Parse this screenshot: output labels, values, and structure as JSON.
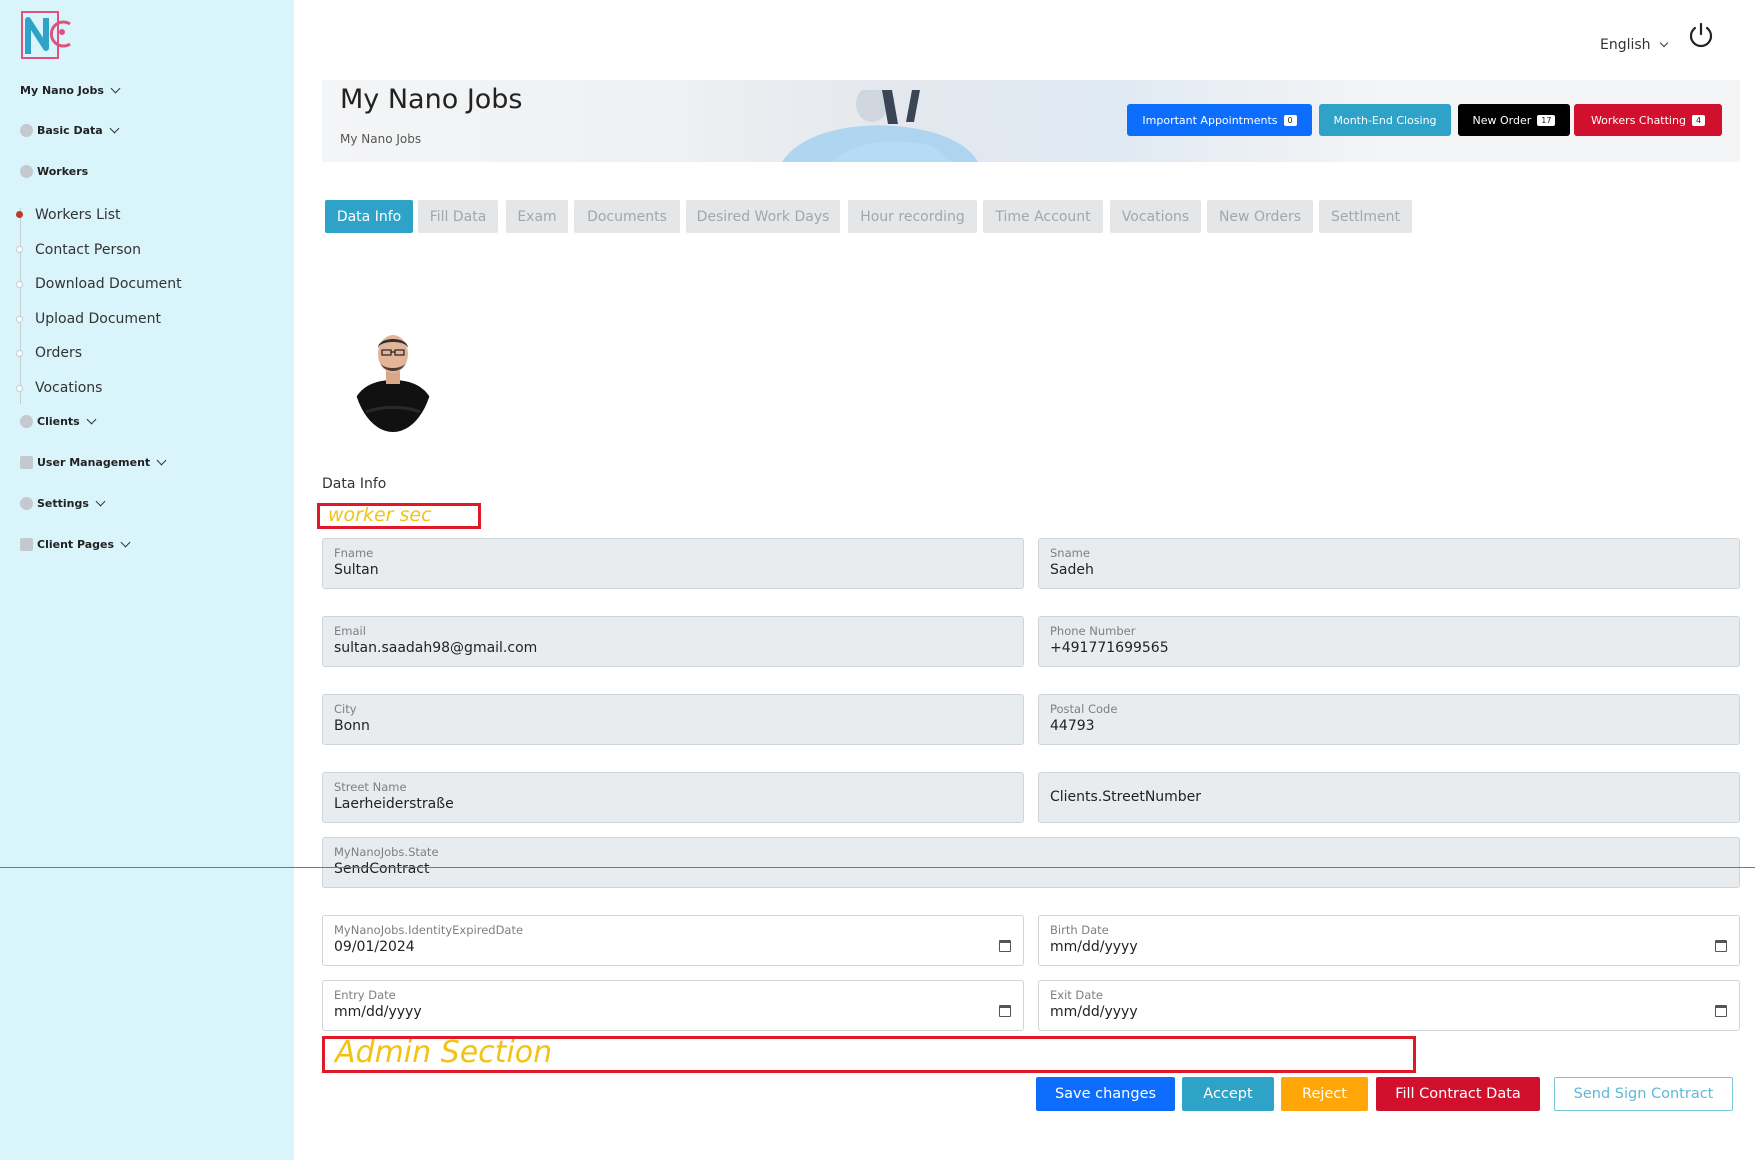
{
  "sidebar": {
    "groups": [
      {
        "label": "My Nano Jobs",
        "icon": "none"
      },
      {
        "label": "Basic Data",
        "icon": "database-icon"
      },
      {
        "label": "Workers",
        "icon": "user-icon"
      },
      {
        "label": "Clients",
        "icon": "users-icon"
      },
      {
        "label": "User Management",
        "icon": "user-cog-icon"
      },
      {
        "label": "Settings",
        "icon": "gear-icon"
      },
      {
        "label": "Client Pages",
        "icon": "page-icon"
      }
    ],
    "worker_items": [
      "Workers List",
      "Contact Person",
      "Download Document",
      "Upload Document",
      "Orders",
      "Vocations"
    ]
  },
  "topbar": {
    "language": "English"
  },
  "header": {
    "title": "My Nano Jobs",
    "breadcrumb": "My Nano Jobs",
    "buttons": [
      {
        "label": "Important Appointments",
        "badge": "0",
        "color": "#0d6efd"
      },
      {
        "label": "Month-End Closing",
        "badge": "",
        "color": "#2fa3c7"
      },
      {
        "label": "New Order",
        "badge": "17",
        "color": "#000000"
      },
      {
        "label": "Workers Chatting",
        "badge": "4",
        "color": "#d0102c"
      }
    ]
  },
  "tabs": [
    "Data Info",
    "Fill Data",
    "Exam",
    "Documents",
    "Desired Work Days",
    "Hour recording",
    "Time Account",
    "Vocations",
    "New Orders",
    "Settlment"
  ],
  "active_tab": "Data Info",
  "form": {
    "section_title": "Data Info",
    "annotation_worker": "worker sec",
    "annotation_admin": "Admin   Section",
    "fname": {
      "label": "Fname",
      "value": "Sultan"
    },
    "sname": {
      "label": "Sname",
      "value": "Sadeh"
    },
    "email": {
      "label": "Email",
      "value": "sultan.saadah98@gmail.com"
    },
    "phone": {
      "label": "Phone Number",
      "value": "+491771699565"
    },
    "city": {
      "label": "City",
      "value": "Bonn"
    },
    "postal": {
      "label": "Postal Code",
      "value": "44793"
    },
    "street": {
      "label": "Street Name",
      "value": "Laerheiderstraße"
    },
    "street_number": {
      "value": "Clients.StreetNumber"
    },
    "state": {
      "label": "MyNanoJobs.State",
      "value": "SendContract"
    },
    "identity_expired": {
      "label": "MyNanoJobs.IdentityExpiredDate",
      "value": "09/01/2024"
    },
    "birth_date": {
      "label": "Birth Date",
      "value": "mm/dd/yyyy"
    },
    "entry_date": {
      "label": "Entry Date",
      "value": "mm/dd/yyyy"
    },
    "exit_date": {
      "label": "Exit Date",
      "value": "mm/dd/yyyy"
    }
  },
  "actions": {
    "save": "Save changes",
    "accept": "Accept",
    "reject": "Reject",
    "fill_contract": "Fill Contract Data",
    "send_sign": "Send Sign Contract"
  },
  "colors": {
    "sidebar_bg": "#d9f5fb",
    "primary": "#0d6efd",
    "info": "#2fa3c7",
    "warning": "#ffa709",
    "danger": "#d0102c",
    "annotation_red": "#e0182a",
    "annotation_yellow": "#f2c314"
  }
}
